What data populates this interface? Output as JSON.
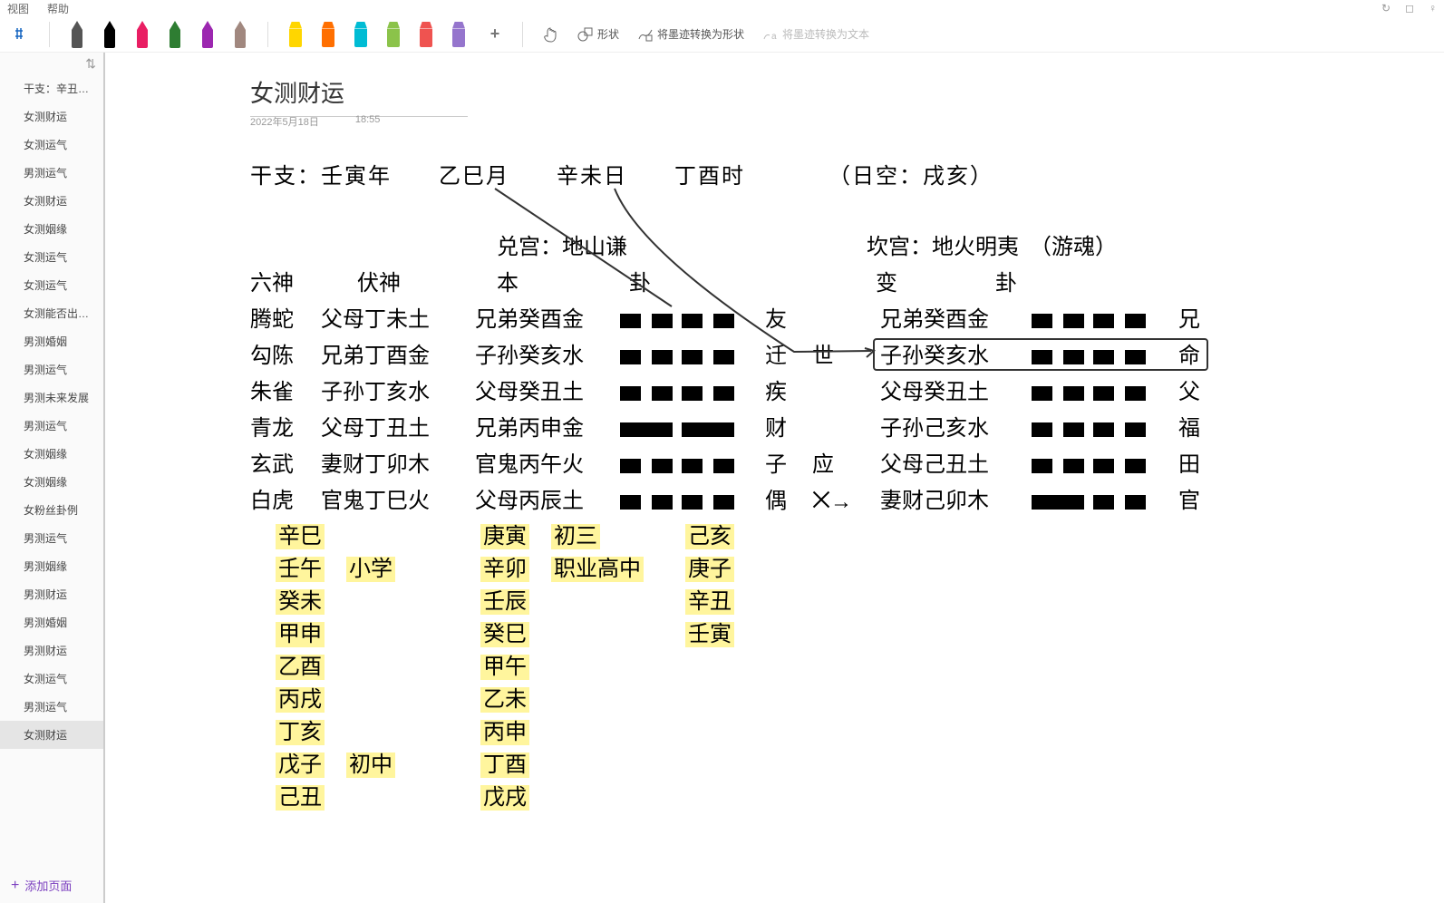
{
  "menu": {
    "view": "视图",
    "help": "帮助"
  },
  "toolbar": {
    "pens": [
      {
        "color": "#555"
      },
      {
        "color": "#000"
      },
      {
        "color": "#e91e63"
      },
      {
        "color": "#2e7d32"
      },
      {
        "color": "#9c27b0"
      },
      {
        "color": "#a1887f"
      }
    ],
    "highlighters": [
      {
        "color": "#ffd600"
      },
      {
        "color": "#ff6f00"
      },
      {
        "color": "#00bcd4"
      },
      {
        "color": "#8bc34a"
      },
      {
        "color": "#ef5350"
      },
      {
        "color": "#9575cd"
      }
    ],
    "shape_label": "形状",
    "ink_to_shape": "将墨迹转换为形状",
    "ink_to_text": "将墨迹转换为文本"
  },
  "sidebar": {
    "items": [
      "干支：辛丑年…",
      "女测财运",
      "女测运气",
      "男测运气",
      "女测财运",
      "女测姻缘",
      "女测运气",
      "女测运气",
      "女测能否出国…",
      "男测婚姻",
      "男测运气",
      "男测未来发展",
      "男测运气",
      "女测姻缘",
      "女测姻缘",
      "女粉丝卦例",
      "男测运气",
      "男测姻缘",
      "男测财运",
      "男测婚姻",
      "男测财运",
      "女测运气",
      "男测运气",
      "女测财运"
    ],
    "active_index": 23,
    "add_page": "添加页面"
  },
  "note": {
    "title": "女测财运",
    "date": "2022年5月18日",
    "time": "18:55",
    "ganzhi_line": "干支：壬寅年　　乙巳月　　辛未日　　丁酉时　　　　（日空：戌亥）",
    "gong_main": "兑宫：地山谦",
    "gong_change": "坎宫：地火明夷　（游魂）",
    "header_liu": "六神",
    "header_fu": "伏神",
    "header_ben": "本",
    "header_gua": "卦",
    "header_bian": "变",
    "header_gua2": "卦",
    "rows": [
      {
        "liu": "腾蛇",
        "fu": "父母丁未土",
        "ben": "兄弟癸酉金",
        "bars": "broken-broken",
        "tag1": "友",
        "tag2": "",
        "bian": "兄弟癸酉金",
        "bars2": "broken-broken",
        "tag3": "兄"
      },
      {
        "liu": "勾陈",
        "fu": "兄弟丁酉金",
        "ben": "子孙癸亥水",
        "bars": "broken-broken",
        "tag1": "迁",
        "tag2": "世",
        "bian": "子孙癸亥水",
        "bars2": "broken-broken",
        "tag3": "命"
      },
      {
        "liu": "朱雀",
        "fu": "子孙丁亥水",
        "ben": "父母癸丑土",
        "bars": "broken-broken",
        "tag1": "疾",
        "tag2": "",
        "bian": "父母癸丑土",
        "bars2": "broken-broken",
        "tag3": "父"
      },
      {
        "liu": "青龙",
        "fu": "父母丁丑土",
        "ben": "兄弟丙申金",
        "bars": "solid-solid",
        "tag1": "财",
        "tag2": "",
        "bian": "子孙己亥水",
        "bars2": "broken-broken",
        "tag3": "福"
      },
      {
        "liu": "玄武",
        "fu": "妻财丁卯木",
        "ben": "官鬼丙午火",
        "bars": "broken-broken",
        "tag1": "子",
        "tag2": "应",
        "bian": "父母己丑土",
        "bars2": "broken-broken",
        "tag3": "田"
      },
      {
        "liu": "白虎",
        "fu": "官鬼丁巳火",
        "ben": "父母丙辰土",
        "bars": "broken-broken",
        "tag1": "偶",
        "tag2": "X→",
        "bian": "妻财己卯木",
        "bars2": "solid-broken",
        "tag3": "官"
      }
    ],
    "col1": [
      "辛巳",
      "壬午　小学",
      "癸未",
      "甲申",
      "乙酉",
      "丙戌",
      "丁亥",
      "戊子　初中",
      "己丑"
    ],
    "col2": [
      "庚寅　初三",
      "辛卯　职业高中",
      "壬辰",
      "癸巳",
      "甲午",
      "乙未",
      "丙申",
      "丁酉",
      "戊戌"
    ],
    "col3": [
      "己亥",
      "庚子",
      "辛丑",
      "壬寅"
    ]
  }
}
